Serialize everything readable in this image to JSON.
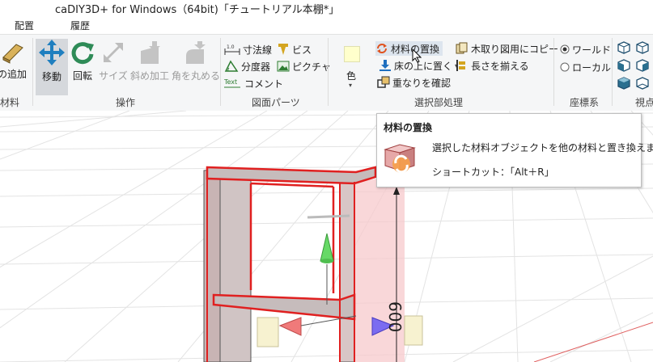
{
  "window": {
    "title": "caDIY3D+ for Windows（64bit)「チュートリアル本棚*」"
  },
  "menu": {
    "items": [
      "配置",
      "履歴"
    ]
  },
  "ribbon": {
    "groups": {
      "material": {
        "label": "材料",
        "button": "の追加"
      },
      "operation": {
        "label": "操作",
        "buttons": [
          "移動",
          "回転",
          "サイズ",
          "斜め加工",
          "角を丸める"
        ]
      },
      "drawing": {
        "label": "図面パーツ",
        "buttons": [
          "寸法線",
          "ビス",
          "分度器",
          "ピクチャ",
          "コメント"
        ]
      },
      "selection": {
        "label": "選択部処理",
        "color_label": "色",
        "buttons": [
          "材料の置換",
          "木取り図用にコピー",
          "床の上に置く",
          "長さを揃える",
          "重なりを確認"
        ]
      },
      "coord": {
        "label": "座標系",
        "options": [
          "ワールド",
          "ローカル"
        ]
      },
      "view": {
        "label": "視点"
      }
    }
  },
  "tooltip": {
    "title": "材料の置換",
    "description": "選択した材料オブジェクトを他の材料と置き換えます。",
    "shortcut": "ショートカット：「Alt＋R」"
  },
  "viewport": {
    "dimension_label": "600"
  }
}
